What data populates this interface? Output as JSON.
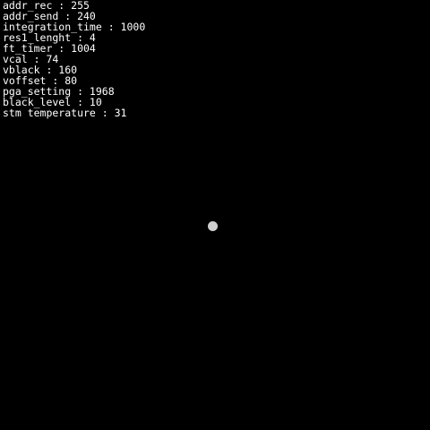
{
  "screen": {
    "background": "#000000",
    "text_color": "#ffffff",
    "dot_color": "#cfcfcf",
    "lines": [
      {
        "text": "addr_rec : 255"
      },
      {
        "text": "addr_send : 240"
      },
      {
        "text": "integration_time : 1000"
      },
      {
        "text": "res1_lenght : 4"
      },
      {
        "text": "ft_timer : 1004"
      },
      {
        "text": "vcal : 74"
      },
      {
        "text": "vblack : 160"
      },
      {
        "text": "voffset : 80"
      },
      {
        "text": "pga_setting : 1968"
      },
      {
        "text": "black_level : 10"
      },
      {
        "text": "stm temperature : 31"
      }
    ]
  }
}
